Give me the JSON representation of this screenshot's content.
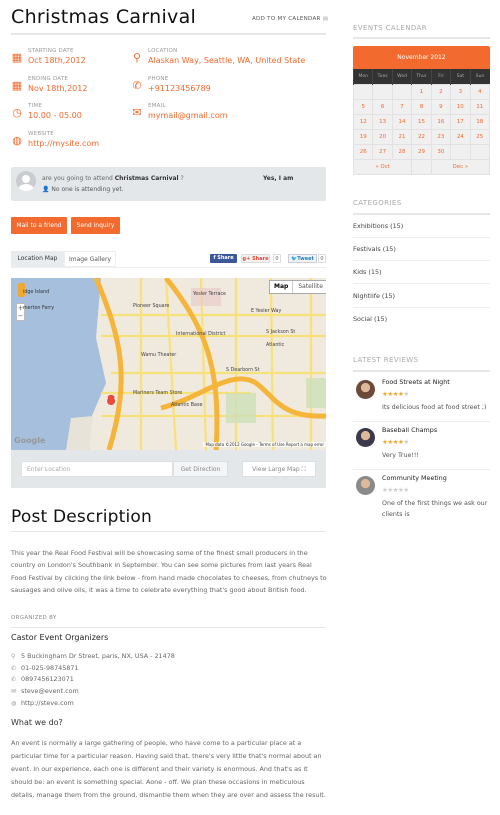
{
  "event": {
    "title": "Christmas Carnival",
    "add_calendar": "ADD TO MY CALENDAR",
    "info": [
      {
        "label": "STARTING DATE",
        "value": "Oct 18th,2012",
        "icon": "calendar-icon"
      },
      {
        "label": "LOCATION",
        "value": "Alaskan Way, Seattle, WA, United State",
        "icon": "map-pin-icon"
      },
      {
        "label": "ENDING DATE",
        "value": "Nov 18th,2012",
        "icon": "calendar-icon"
      },
      {
        "label": "PHONE",
        "value": "+91123456789",
        "icon": "phone-icon"
      },
      {
        "label": "TIME",
        "value": "10.00 - 05.00",
        "icon": "clock-icon"
      },
      {
        "label": "EMAIL",
        "value": "mymail@gmail.com",
        "icon": "envelope-icon"
      },
      {
        "label": "WEBSITE",
        "value": "http://mysite.com",
        "icon": "globe-icon"
      }
    ]
  },
  "attend": {
    "prefix": "are you going to attend",
    "event": "Christmas Carnival",
    "suffix": "?",
    "yes": "Yes, I am",
    "none": "No one is attending yet."
  },
  "actions": {
    "mail": "Mail to a friend",
    "inquiry": "Send inquiry"
  },
  "tabs": [
    "Location Map",
    "Image Gallery"
  ],
  "social": {
    "fb": "Share",
    "gplus": "Share",
    "gplus_count": "0",
    "tweet": "Tweet",
    "tweet_count": "0"
  },
  "map": {
    "type_map": "Map",
    "type_sat": "Satellite",
    "labels": [
      "Yesler Terrace",
      "Pioneer Square",
      "E Yesler Way",
      "International District",
      "S Jackson St",
      "Atlantic",
      "Wamu Theater",
      "S Dearborn St",
      "Mariners Team Store",
      "Atlantic Base",
      "idge Island",
      "merton Ferry"
    ],
    "attribution": "Map data ©2012 Google - Terms of Use  Report a map error",
    "logo": "Google"
  },
  "directions": {
    "placeholder": "Enter Location",
    "get": "Get Direction",
    "large": "View Large Map"
  },
  "post": {
    "heading": "Post Description",
    "body": "This year the Real Food Festival will be showcasing some of the finest small producers in the country on London's Southbank in September. You can see some pictures from last years Real Food Festival by clicking the link below - from hand made chocolates to cheeses, from chutneys to sausages and olive oils, it was a time to celebrate everything that's good about British food."
  },
  "organizer": {
    "label": "ORGANIZED BY",
    "name": "Castor Event Organizers",
    "details": [
      {
        "icon": "map-pin-icon",
        "text": "5 Buckingham Dr Street, paris, NX, USA - 21478"
      },
      {
        "icon": "phone-icon",
        "text": "01-025-98745871"
      },
      {
        "icon": "phone-icon",
        "text": "0897456123071"
      },
      {
        "icon": "envelope-icon",
        "text": "steve@event.com"
      },
      {
        "icon": "globe-icon",
        "text": "http://steve.com"
      }
    ],
    "what_heading": "What we do?",
    "what_body": "An event is normally a large gathering of people, who have come to a particular place at a particular time for a particular reason. Having said that, there's very little that's normal about an event. In our experience, each one is different and their variety is enormous. And that's as it should be: an event is something special. Aone - off. We plan these occasions in meticulous details, manage them from the ground, dismantle them when they are over and assess the result."
  },
  "sidebar": {
    "calendar": {
      "heading": "EVENTS CALENDAR",
      "month": "November 2012",
      "days": [
        "Mon",
        "Tues",
        "Wed",
        "Thur",
        "Fri",
        "Sat",
        "Sun"
      ],
      "weeks": [
        [
          "",
          "",
          "",
          "1",
          "2",
          "3",
          "4"
        ],
        [
          "5",
          "6",
          "7",
          "8",
          "9",
          "10",
          "11"
        ],
        [
          "12",
          "13",
          "14",
          "15",
          "16",
          "17",
          "18"
        ],
        [
          "19",
          "20",
          "21",
          "22",
          "23",
          "24",
          "25"
        ],
        [
          "26",
          "27",
          "28",
          "29",
          "30",
          "",
          ""
        ]
      ],
      "prev": "« Oct",
      "next": "Dec »"
    },
    "categories": {
      "heading": "CATEGORIES",
      "items": [
        "Exhibitions (15)",
        "Festivals (15)",
        "Kids (15)",
        "Nightlife (15)",
        "Social (15)"
      ]
    },
    "reviews": {
      "heading": "LATEST REVIEWS",
      "items": [
        {
          "title": "Food Streets at Night",
          "rating": 4,
          "text": "Its delicious food at food street ;)"
        },
        {
          "title": "Baseball Champs",
          "rating": 4,
          "text": "Very True!!!"
        },
        {
          "title": "Community Meeting",
          "rating": 0,
          "text": "One of the first things we ask our clients is"
        }
      ]
    }
  },
  "colors": {
    "accent": "#f26a2e",
    "star": "#f5a623"
  }
}
